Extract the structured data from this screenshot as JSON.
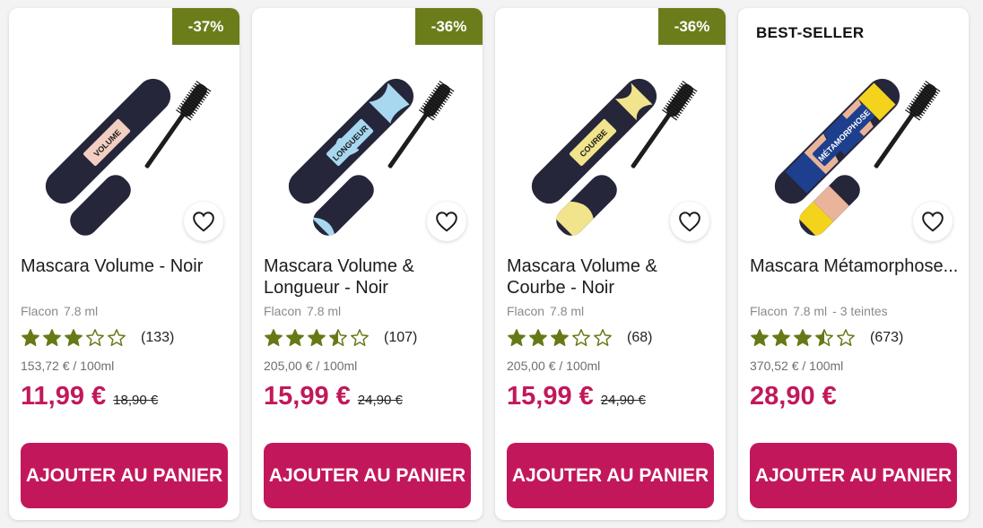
{
  "colors": {
    "accent": "#c2185b",
    "badge": "#6b7d1b",
    "star": "#657a16"
  },
  "products": [
    {
      "badge": "-37%",
      "name": "Mascara Volume - Noir",
      "label": "VOLUME",
      "label_color": "#f2cfc2",
      "pattern": "none",
      "format": "Flacon",
      "volume": "7.8 ml",
      "shades": "",
      "rating": 3,
      "reviews": "(133)",
      "unit_price": "153,72 € / 100ml",
      "price": "11,99 €",
      "old_price": "18,90 €",
      "button": "AJOUTER AU PANIER",
      "heart_icon": "heart-outline-icon"
    },
    {
      "badge": "-36%",
      "name": "Mascara Volume & Longueur - Noir",
      "label": "LONGUEUR",
      "label_color": "#a8d8f0",
      "pattern": "blue",
      "format": "Flacon",
      "volume": "7.8 ml",
      "shades": "",
      "rating": 3.5,
      "reviews": "(107)",
      "unit_price": "205,00 € / 100ml",
      "price": "15,99 €",
      "old_price": "24,90 €",
      "button": "AJOUTER AU PANIER",
      "heart_icon": "heart-outline-icon"
    },
    {
      "badge": "-36%",
      "name": "Mascara Volume & Courbe - Noir",
      "label": "COURBE",
      "label_color": "#f1e48c",
      "pattern": "yellow",
      "format": "Flacon",
      "volume": "7.8 ml",
      "shades": "",
      "rating": 3,
      "reviews": "(68)",
      "unit_price": "205,00 € / 100ml",
      "price": "15,99 €",
      "old_price": "24,90 €",
      "button": "AJOUTER AU PANIER",
      "heart_icon": "heart-outline-icon"
    },
    {
      "badge": "",
      "tag": "BEST-SELLER",
      "name": "Mascara Métamorphose...",
      "label": "MÉTAMORPHOSE",
      "label_color": "#1d3f8e",
      "pattern": "multi",
      "format": "Flacon",
      "volume": "7.8 ml",
      "shades": "- 3 teintes",
      "rating": 3.5,
      "reviews": "(673)",
      "unit_price": "370,52 € / 100ml",
      "price": "28,90 €",
      "old_price": "",
      "button": "AJOUTER AU PANIER",
      "heart_icon": "heart-outline-icon"
    }
  ]
}
